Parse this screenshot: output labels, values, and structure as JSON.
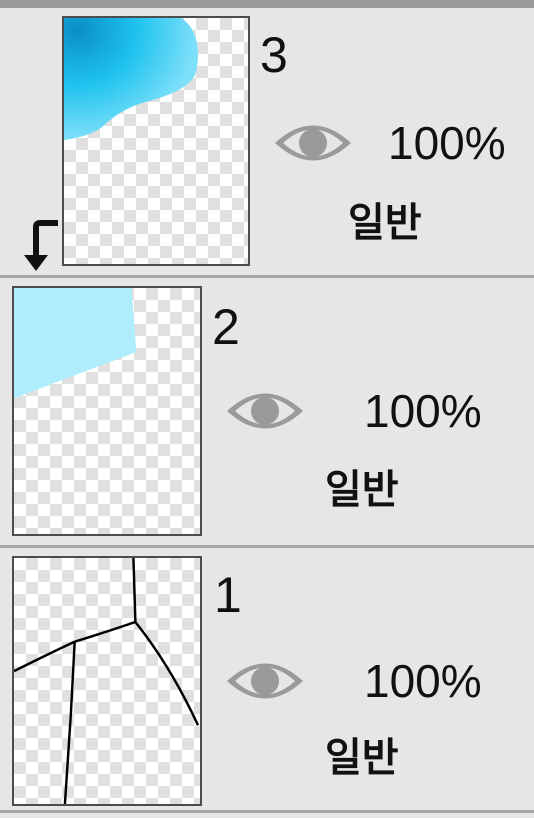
{
  "layers": [
    {
      "number": "3",
      "opacity": "100%",
      "blend_mode": "일반",
      "visible": true,
      "clipped": true,
      "thumb_color": "#1fc3ee"
    },
    {
      "number": "2",
      "opacity": "100%",
      "blend_mode": "일반",
      "visible": true,
      "clipped": false,
      "thumb_color": "#aeeefc"
    },
    {
      "number": "1",
      "opacity": "100%",
      "blend_mode": "일반",
      "visible": true,
      "clipped": false,
      "thumb_color": "#000000"
    }
  ],
  "icons": {
    "visibility": "eye-icon",
    "clipping": "clipping-arrow-icon"
  },
  "colors": {
    "background": "#e6e6e6",
    "divider": "#a6a6a6",
    "eye_gray": "#999999"
  }
}
